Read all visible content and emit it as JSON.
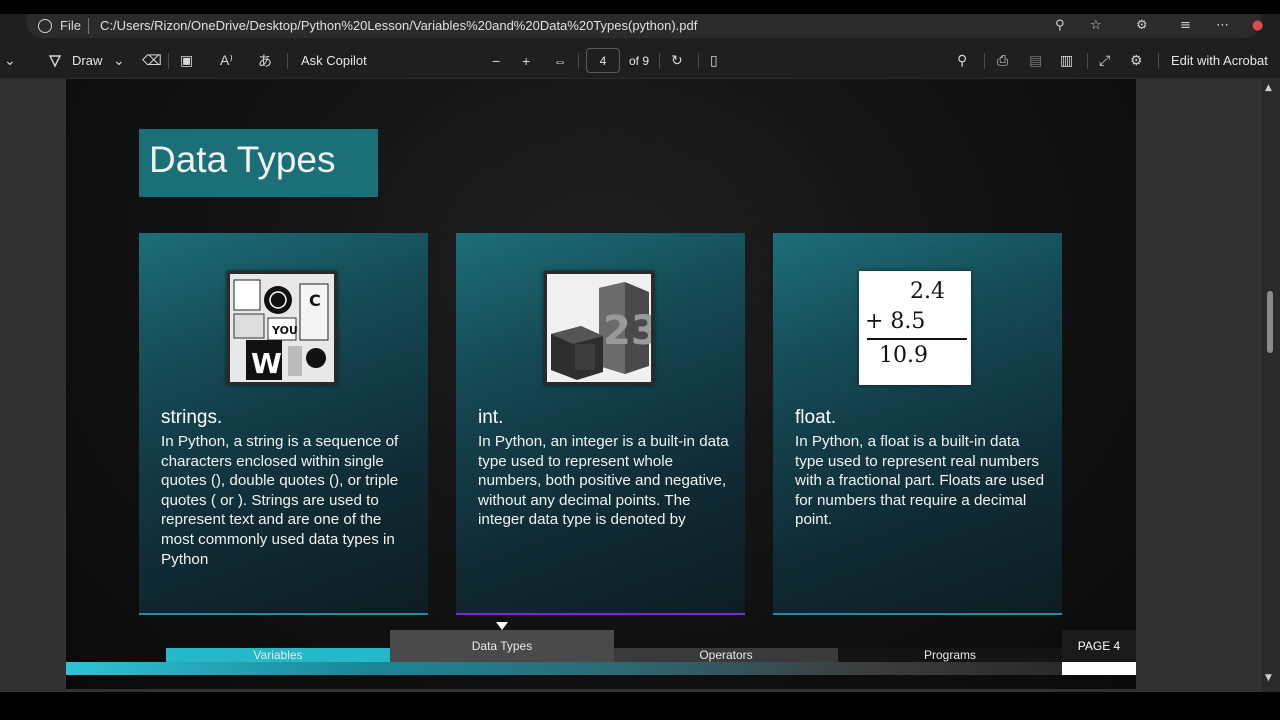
{
  "browser": {
    "file_label": "File",
    "url": "C:/Users/Rizon/OneDrive/Desktop/Python%20Lesson/Variables%20and%20Data%20Types(python).pdf"
  },
  "toolbar": {
    "draw_label": "Draw",
    "ask_copilot_label": "Ask Copilot",
    "page_current": "4",
    "page_total_label": "of 9",
    "edit_acrobat_label": "Edit with Acrobat"
  },
  "slide": {
    "title": "Data Types",
    "cards": [
      {
        "heading": "strings.",
        "body": "In Python, a string is a sequence of characters enclosed within single quotes (), double quotes (), or triple quotes ( or ). Strings are used to represent text and are one of the most commonly used data types in Python",
        "image": "strings-collage"
      },
      {
        "heading": "int.",
        "body": "In Python, an integer is a built-in data type used to represent whole numbers, both positive and negative, without any decimal points. The integer data type is denoted by",
        "image": "number-blocks-23"
      },
      {
        "heading": "float.",
        "body": "In Python, a float is a built-in data type used to represent real numbers with a fractional part. Floats are used for numbers that require a decimal point.",
        "image": "decimal-addition",
        "image_text": {
          "line1": "2.4",
          "line2": "+ 8.5",
          "line3": "10.9"
        }
      }
    ],
    "nav": {
      "tabs": [
        "Variables",
        "Data Types",
        "Operators",
        "Programs"
      ],
      "active_tab": "Data Types",
      "page_label": "PAGE 4"
    }
  },
  "colors": {
    "title_box": "#1b6f77",
    "accent_cyan": "#2cc3d4",
    "card_line_purple": "#7a2bd0",
    "card_line_teal": "#2a8a9a"
  }
}
